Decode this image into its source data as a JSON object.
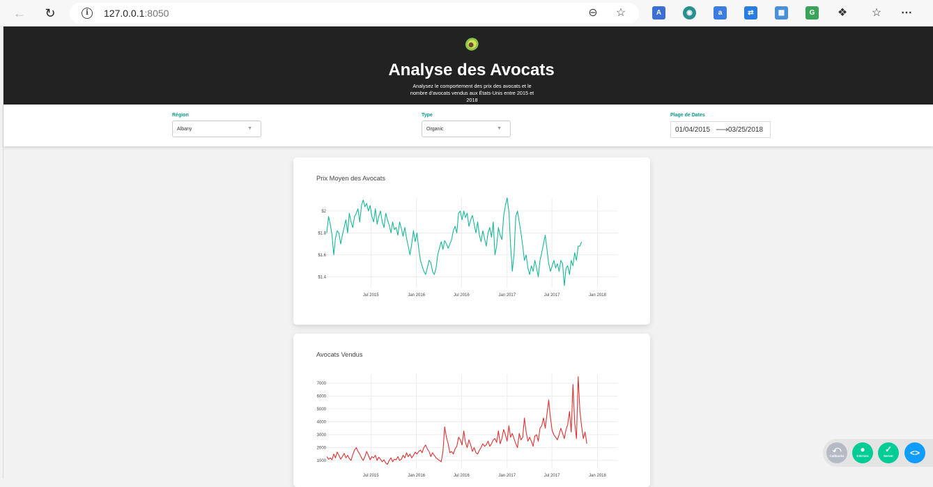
{
  "browser": {
    "url_host": "127.0.0.1",
    "url_port": ":8050"
  },
  "header": {
    "title": "Analyse des Avocats",
    "description": "Analysez le comportement des prix des avocats et le nombre d'avocats vendus aux États-Unis entre 2015 et 2018"
  },
  "filters": {
    "region_label": "Région",
    "region_value": "Albany",
    "type_label": "Type",
    "type_value": "Organic",
    "date_label": "Plage de Dates",
    "start_date": "01/04/2015",
    "end_date": "03/25/2018"
  },
  "chart_data": [
    {
      "type": "line",
      "title": "Prix Moyen des Avocats",
      "xlabel": "",
      "ylabel": "",
      "x_ticks": [
        "Jul 2015",
        "Jan 2016",
        "Jul 2016",
        "Jan 2017",
        "Jul 2017",
        "Jan 2018"
      ],
      "y_ticks": [
        "$1.4",
        "$1.6",
        "$1.8",
        "$2"
      ],
      "ylim": [
        1.3,
        2.12
      ],
      "x_range": [
        "2015-01-04",
        "2018-03-25"
      ],
      "color": "#17b897",
      "grid": true,
      "series": [
        {
          "x_start": "2015-01-04",
          "x_step_days": 7,
          "values": [
            1.8,
            1.95,
            1.88,
            1.78,
            1.6,
            1.75,
            1.82,
            1.8,
            1.7,
            1.78,
            1.85,
            1.92,
            1.8,
            1.98,
            1.9,
            1.85,
            1.95,
            1.98,
            2.02,
            1.9,
            2.05,
            2.1,
            2.04,
            2.07,
            2.0,
            2.05,
            1.95,
            1.9,
            2.02,
            1.88,
            1.95,
            2.0,
            1.9,
            1.85,
            1.98,
            1.92,
            1.87,
            1.8,
            1.9,
            1.83,
            1.85,
            1.78,
            1.9,
            1.84,
            1.77,
            1.85,
            1.75,
            1.68,
            1.6,
            1.7,
            1.82,
            1.72,
            1.8,
            1.66,
            1.55,
            1.5,
            1.45,
            1.42,
            1.48,
            1.55,
            1.53,
            1.45,
            1.42,
            1.48,
            1.6,
            1.66,
            1.72,
            1.65,
            1.73,
            1.7,
            1.66,
            1.7,
            1.74,
            1.82,
            1.86,
            1.8,
            1.98,
            2.0,
            1.92,
            2.0,
            1.94,
            1.98,
            1.86,
            1.92,
            1.96,
            1.88,
            1.8,
            1.9,
            1.78,
            1.72,
            1.82,
            1.75,
            1.68,
            1.8,
            1.85,
            1.76,
            1.9,
            1.6,
            1.68,
            1.85,
            1.78,
            1.74,
            1.95,
            2.05,
            2.12,
            2.0,
            1.7,
            1.45,
            1.6,
            1.95,
            2.0,
            1.9,
            1.8,
            1.68,
            1.55,
            1.6,
            1.48,
            1.42,
            1.5,
            1.45,
            1.55,
            1.48,
            1.4,
            1.55,
            1.62,
            1.7,
            1.78,
            1.65,
            1.52,
            1.45,
            1.5,
            1.55,
            1.48,
            1.52,
            1.45,
            1.55,
            1.52,
            1.32,
            1.48,
            1.5,
            1.42,
            1.55,
            1.5,
            1.62,
            1.55,
            1.68,
            1.68,
            1.72
          ]
        }
      ]
    },
    {
      "type": "line",
      "title": "Avocats Vendus",
      "xlabel": "",
      "ylabel": "",
      "x_ticks": [
        "Jul 2015",
        "Jan 2016",
        "Jul 2016",
        "Jan 2017",
        "Jul 2017",
        "Jan 2018"
      ],
      "y_ticks": [
        "1000",
        "2000",
        "3000",
        "4000",
        "5000",
        "6000",
        "7000"
      ],
      "ylim": [
        400,
        7700
      ],
      "x_range": [
        "2015-01-04",
        "2018-03-25"
      ],
      "color": "#e03131",
      "grid": true,
      "series": [
        {
          "x_start": "2015-01-04",
          "x_step_days": 7,
          "values": [
            1300,
            1100,
            1200,
            1050,
            1500,
            1200,
            1650,
            1400,
            1100,
            1300,
            1550,
            1200,
            1400,
            1150,
            1000,
            1450,
            1800,
            2000,
            1700,
            1500,
            1200,
            1000,
            1300,
            1700,
            1400,
            1050,
            1300,
            1200,
            1400,
            1000,
            1250,
            1100,
            900,
            1050,
            800,
            700,
            1000,
            1200,
            900,
            1100,
            1050,
            1300,
            1000,
            1100,
            1400,
            1200,
            1600,
            1300,
            1500,
            1200,
            1400,
            1650,
            1500,
            1700,
            1800,
            1600,
            2000,
            2200,
            1900,
            1700,
            1300,
            1600,
            1400,
            1200,
            1100,
            1000,
            900,
            1700,
            3600,
            2800,
            2300,
            1600,
            1700,
            1500,
            1900,
            2100,
            2800,
            2600,
            2200,
            3300,
            2400,
            2000,
            2600,
            2200,
            1700,
            2000,
            1600,
            1500,
            1800,
            2000,
            2300,
            2100,
            2200,
            2500,
            2100,
            2300,
            2600,
            2700,
            2400,
            3300,
            2300,
            2700,
            3400,
            3000,
            2500,
            3700,
            2800,
            3100,
            2700,
            2300,
            2000,
            3100,
            2600,
            2800,
            4300,
            3200,
            2500,
            2800,
            2500,
            2100,
            2900,
            3000,
            2500,
            3500,
            3700,
            4300,
            3500,
            4600,
            5700,
            4300,
            3300,
            3000,
            2800,
            2600,
            3000,
            3500,
            3100,
            2700,
            3400,
            3800,
            4800,
            3200,
            6900,
            3900,
            2700,
            7500,
            4800,
            3600,
            2700,
            3200,
            2300
          ]
        }
      ]
    }
  ]
}
